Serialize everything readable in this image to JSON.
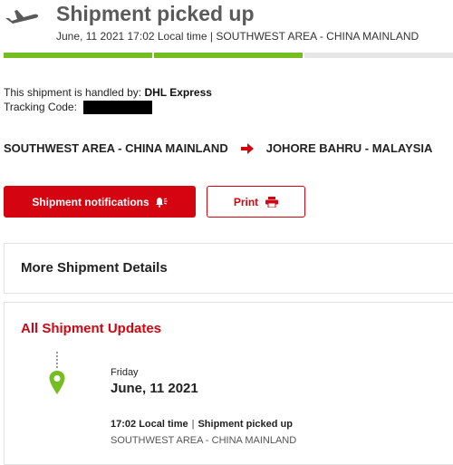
{
  "header": {
    "icon": "airplane-icon",
    "status": "Shipment picked up",
    "subtitle": "June, 11 2021 17:02 Local time | SOUTHWEST AREA - CHINA MAINLAND"
  },
  "progress": {
    "completed_fraction": 0.667,
    "colors": {
      "done": "#76bd22",
      "pending": "#e6e6e6"
    }
  },
  "info": {
    "handled_by_label": "This shipment is handled by:",
    "handled_by_value": "DHL Express",
    "tracking_label": "Tracking Code:"
  },
  "route": {
    "origin": "SOUTHWEST AREA - CHINA MAINLAND",
    "destination": "JOHORE BAHRU - MALAYSIA",
    "arrow_icon": "arrow-right-icon"
  },
  "actions": {
    "notifications_label": "Shipment notifications",
    "notifications_icon": "bell-icon",
    "print_label": "Print",
    "print_icon": "printer-icon"
  },
  "more_details": {
    "title": "More Shipment Details"
  },
  "updates": {
    "title": "All Shipment Updates",
    "entries": [
      {
        "day": "Friday",
        "date": "June, 11 2021",
        "time": "17:02 Local time",
        "separator": "|",
        "status": "Shipment picked up",
        "location": "SOUTHWEST AREA - CHINA MAINLAND"
      }
    ]
  },
  "colors": {
    "brand_red": "#d40511",
    "pin_green": "#76bd22",
    "heading_gray": "#5a5a5a"
  }
}
